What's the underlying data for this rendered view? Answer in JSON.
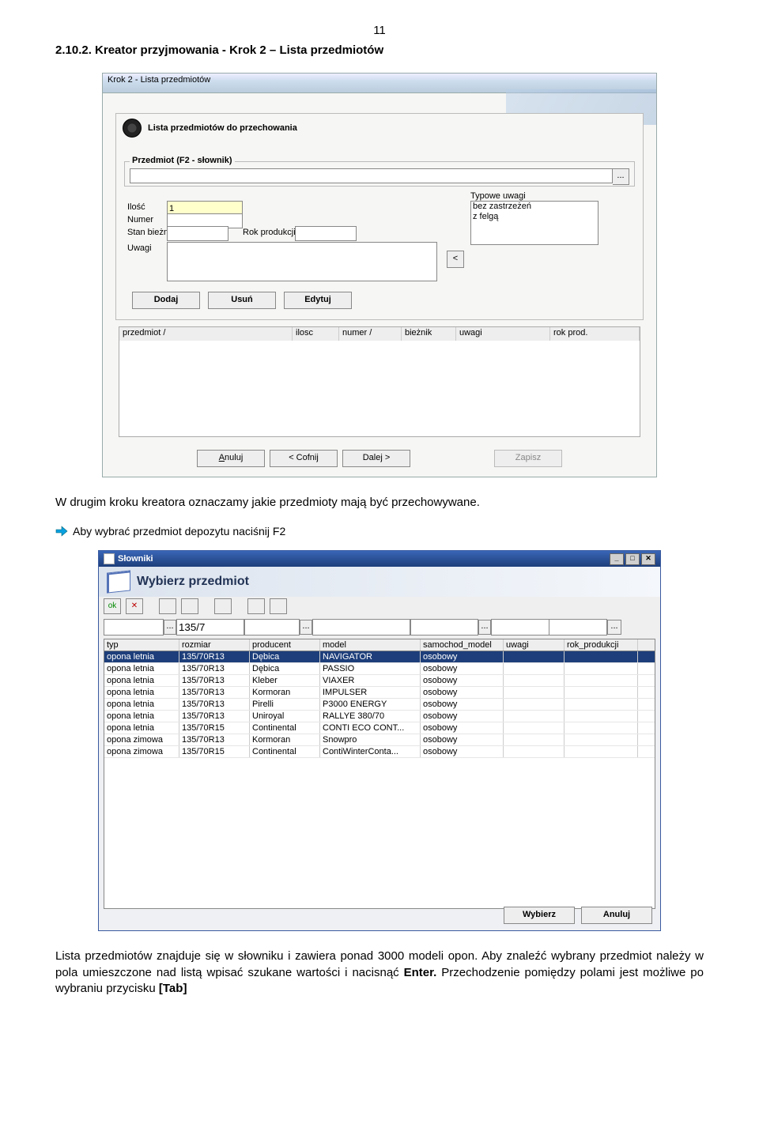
{
  "page_number": "11",
  "section_heading": "2.10.2. Kreator przyjmowania - Krok 2 – Lista przedmiotów",
  "para1": "W drugim kroku kreatora oznaczamy jakie przedmioty mają być przechowywane.",
  "tip1": " Aby wybrać przedmiot depozytu naciśnij F2",
  "para2_a": "Lista przedmiotów znajduje się w słowniku i zawiera ponad 3000 modeli opon. Aby znaleźć wybrany przedmiot należy w pola umieszczone nad listą wpisać szukane wartości i nacisnąć ",
  "para2_bold": "Enter.",
  "para2_b": " Przechodzenie pomiędzy polami jest możliwe po wybraniu przycisku ",
  "para2_key": "[Tab]",
  "win1": {
    "title": "Krok 2 - Lista przedmiotów",
    "subtitle": "Lista przedmiotów do przechowania",
    "group_label": "Przedmiot (F2 - słownik)",
    "labels": {
      "ilosc": "Ilość",
      "numer": "Numer",
      "stan": "Stan bieżnika",
      "rok": "Rok produkcji",
      "uwagi": "Uwagi",
      "typowe": "Typowe uwagi"
    },
    "ilosc_value": "1",
    "typowe_uwagi": [
      "bez zastrzeżeń",
      "z felgą"
    ],
    "buttons": {
      "dodaj": "Dodaj",
      "usun": "Usuń",
      "edytuj": "Edytuj"
    },
    "list_headers": [
      "przedmiot /",
      "ilosc",
      "numer /",
      "bieżnik",
      "uwagi",
      "rok prod."
    ],
    "bottom": {
      "anuluj": "Anuluj",
      "cofnij": "< Cofnij",
      "dalej": "Dalej >",
      "zapisz": "Zapisz"
    }
  },
  "win2": {
    "title": "Słowniki",
    "select_label": "Wybierz przedmiot",
    "filter_value": "135/7",
    "toolbar": {
      "ok": "ok",
      "x": "✕"
    },
    "grid_headers": [
      "typ",
      "rozmiar",
      "producent",
      "model",
      "samochod_model",
      "uwagi",
      "rok_produkcji"
    ],
    "rows": [
      {
        "typ": "opona letnia",
        "rozmiar": "135/70R13",
        "producent": "Dębica",
        "model": "NAVIGATOR",
        "sam": "osobowy",
        "uwagi": "",
        "rok": ""
      },
      {
        "typ": "opona letnia",
        "rozmiar": "135/70R13",
        "producent": "Dębica",
        "model": "PASSIO",
        "sam": "osobowy",
        "uwagi": "",
        "rok": ""
      },
      {
        "typ": "opona letnia",
        "rozmiar": "135/70R13",
        "producent": "Kleber",
        "model": "VIAXER",
        "sam": "osobowy",
        "uwagi": "",
        "rok": ""
      },
      {
        "typ": "opona letnia",
        "rozmiar": "135/70R13",
        "producent": "Kormoran",
        "model": "IMPULSER",
        "sam": "osobowy",
        "uwagi": "",
        "rok": ""
      },
      {
        "typ": "opona letnia",
        "rozmiar": "135/70R13",
        "producent": "Pirelli",
        "model": "P3000 ENERGY",
        "sam": "osobowy",
        "uwagi": "",
        "rok": ""
      },
      {
        "typ": "opona letnia",
        "rozmiar": "135/70R13",
        "producent": "Uniroyal",
        "model": "RALLYE 380/70",
        "sam": "osobowy",
        "uwagi": "",
        "rok": ""
      },
      {
        "typ": "opona letnia",
        "rozmiar": "135/70R15",
        "producent": "Continental",
        "model": "CONTI ECO CONT...",
        "sam": "osobowy",
        "uwagi": "",
        "rok": ""
      },
      {
        "typ": "opona zimowa",
        "rozmiar": "135/70R13",
        "producent": "Kormoran",
        "model": "Snowpro",
        "sam": "osobowy",
        "uwagi": "",
        "rok": ""
      },
      {
        "typ": "opona zimowa",
        "rozmiar": "135/70R15",
        "producent": "Continental",
        "model": "ContiWinterConta...",
        "sam": "osobowy",
        "uwagi": "",
        "rok": ""
      }
    ],
    "buttons": {
      "wybierz": "Wybierz",
      "anuluj": "Anuluj"
    }
  }
}
